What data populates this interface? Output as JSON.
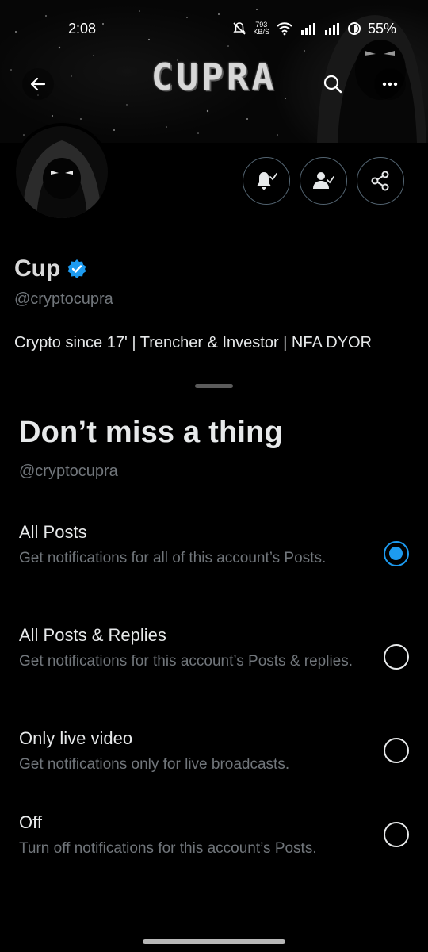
{
  "status_bar": {
    "time": "2:08",
    "network_speed": "793",
    "network_speed_unit": "KB/S",
    "battery": "55%"
  },
  "banner": {
    "title": "CUPRA"
  },
  "profile": {
    "name": "Cup",
    "handle": "@cryptocupra",
    "bio": "Crypto since 17' | Trencher & Investor | NFA DYOR",
    "verified": true
  },
  "sheet": {
    "title": "Don’t miss a thing",
    "subtitle": "@cryptocupra",
    "options": [
      {
        "title": "All Posts",
        "description": "Get notifications for all of this account’s Posts.",
        "selected": true
      },
      {
        "title": "All Posts & Replies",
        "description": "Get notifications for this account’s Posts & replies.",
        "selected": false
      },
      {
        "title": "Only live video",
        "description": "Get notifications only for live broadcasts.",
        "selected": false
      },
      {
        "title": "Off",
        "description": "Turn off notifications for this account’s Posts.",
        "selected": false
      }
    ]
  },
  "colors": {
    "accent": "#1d9bf0",
    "background": "#000000",
    "secondary_text": "#71767b",
    "primary_text": "#e7e9ea"
  },
  "icons": {
    "nav_back": "arrow-left-icon",
    "nav_search": "search-icon",
    "nav_more": "more-horizontal-icon",
    "bell": "bell-check-icon",
    "follow": "user-check-icon",
    "share": "share-icon",
    "verified": "verified-badge-icon"
  }
}
